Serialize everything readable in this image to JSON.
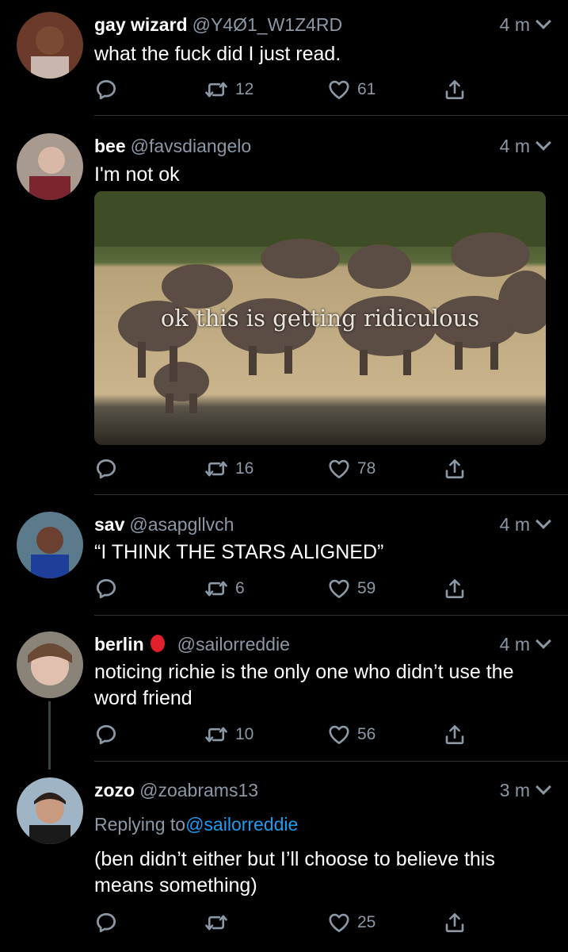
{
  "tweets": [
    {
      "name": "gay wizard",
      "handle": "@Y4Ø1_W1Z4RD",
      "time": "4 m",
      "text": "what the fuck did I just read.",
      "retweets": "12",
      "likes": "61"
    },
    {
      "name": "bee",
      "handle": "@favsdiangelo",
      "time": "4 m",
      "text": "I'm not ok",
      "media_caption": "ok this is getting ridiculous",
      "retweets": "16",
      "likes": "78"
    },
    {
      "name": "sav",
      "handle": "@asapgllvch",
      "time": "4 m",
      "text": "“I THINK THE STARS ALIGNED”",
      "retweets": "6",
      "likes": "59"
    },
    {
      "name": "berlin",
      "handle": "@sailorreddie",
      "time": "4 m",
      "text": "noticing richie is the only one who didn’t use the word friend",
      "retweets": "10",
      "likes": "56"
    },
    {
      "name": "zozo",
      "handle": "@zoabrams13",
      "time": "3 m",
      "replying_label": "Replying to",
      "replying_handle": "@sailorreddie",
      "text": "(ben didn’t either but I’ll choose to believe this means something)",
      "retweets": "",
      "likes": "25"
    }
  ],
  "icons": {
    "reply": "reply-icon",
    "retweet": "retweet-icon",
    "like": "heart-icon",
    "share": "share-icon",
    "menu": "chevron-down-icon"
  },
  "colors": {
    "background": "#000000",
    "muted": "#8b98a5",
    "link": "#1d9bf0"
  }
}
